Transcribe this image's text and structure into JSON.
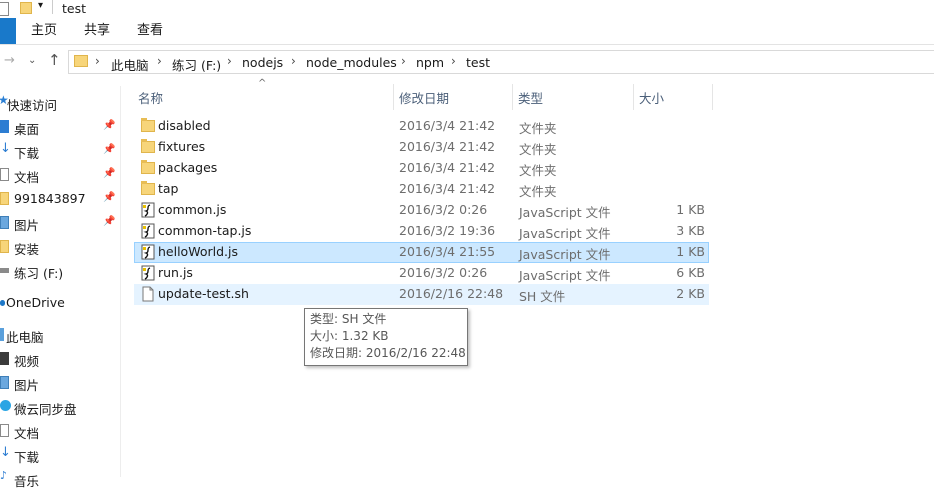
{
  "window": {
    "title": "test"
  },
  "ribbon": {
    "tabs": {
      "file": "",
      "home": "主页",
      "share": "共享",
      "view": "查看"
    }
  },
  "address": {
    "crumbs": [
      "此电脑",
      "练习 (F:)",
      "nodejs",
      "node_modules",
      "npm",
      "test"
    ]
  },
  "sidebar": {
    "items": [
      {
        "label": "快速访问"
      },
      {
        "label": "桌面"
      },
      {
        "label": "下载"
      },
      {
        "label": "文档"
      },
      {
        "label": "991843897"
      },
      {
        "label": "图片"
      },
      {
        "label": "安装"
      },
      {
        "label": "练习 (F:)"
      },
      {
        "label": "OneDrive"
      },
      {
        "label": "此电脑"
      },
      {
        "label": "视频"
      },
      {
        "label": "图片"
      },
      {
        "label": "微云同步盘"
      },
      {
        "label": "文档"
      },
      {
        "label": "下载"
      },
      {
        "label": "音乐"
      }
    ]
  },
  "columns": {
    "name": "名称",
    "modified": "修改日期",
    "type": "类型",
    "size": "大小"
  },
  "files": [
    {
      "name": "disabled",
      "date": "2016/3/4 21:42",
      "type": "文件夹",
      "size": ""
    },
    {
      "name": "fixtures",
      "date": "2016/3/4 21:42",
      "type": "文件夹",
      "size": ""
    },
    {
      "name": "packages",
      "date": "2016/3/4 21:42",
      "type": "文件夹",
      "size": ""
    },
    {
      "name": "tap",
      "date": "2016/3/4 21:42",
      "type": "文件夹",
      "size": ""
    },
    {
      "name": "common.js",
      "date": "2016/3/2 0:26",
      "type": "JavaScript 文件",
      "size": "1 KB"
    },
    {
      "name": "common-tap.js",
      "date": "2016/3/2 19:36",
      "type": "JavaScript 文件",
      "size": "3 KB"
    },
    {
      "name": "helloWorld.js",
      "date": "2016/3/4 21:55",
      "type": "JavaScript 文件",
      "size": "1 KB"
    },
    {
      "name": "run.js",
      "date": "2016/3/2 0:26",
      "type": "JavaScript 文件",
      "size": "6 KB"
    },
    {
      "name": "update-test.sh",
      "date": "2016/2/16 22:48",
      "type": "SH 文件",
      "size": "2 KB"
    }
  ],
  "tooltip": {
    "type": "类型: SH 文件",
    "size": "大小: 1.32 KB",
    "modified": "修改日期: 2016/2/16 22:48"
  }
}
